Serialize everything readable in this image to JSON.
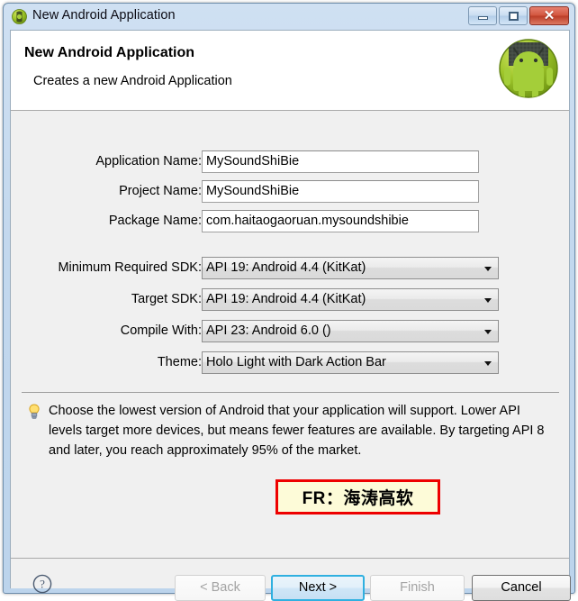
{
  "window": {
    "title": "New Android Application",
    "icon": "android-circle-icon",
    "controls": {
      "minimize": "minimize-icon",
      "maximize": "maximize-icon",
      "close": "close-icon"
    }
  },
  "header": {
    "title": "New Android Application",
    "subtitle": "Creates a new Android Application",
    "logo": "android-robot-icon"
  },
  "form": {
    "text_fields": [
      {
        "label": "Application Name:",
        "value": "MySoundShiBie",
        "info": "i"
      },
      {
        "label": "Project Name:",
        "value": "MySoundShiBie",
        "info": "i"
      },
      {
        "label": "Package Name:",
        "value": "com.haitaogaoruan.mysoundshibie",
        "info": "i"
      }
    ],
    "combo_fields": [
      {
        "label": "Minimum Required SDK:",
        "value": "API 19: Android 4.4 (KitKat)",
        "info": "i"
      },
      {
        "label": "Target SDK:",
        "value": "API 19: Android 4.4 (KitKat)",
        "info": "i"
      },
      {
        "label": "Compile With:",
        "value": "API 23: Android 6.0 ()",
        "info": "i"
      },
      {
        "label": "Theme:",
        "value": "Holo Light with Dark Action Bar",
        "info": "i"
      }
    ]
  },
  "hint": {
    "icon": "lightbulb-icon",
    "text": "Choose the lowest version of Android that your application will support. Lower API levels target more devices, but means fewer features are available. By targeting API 8 and later, you reach approximately 95% of the market."
  },
  "watermark": {
    "text": "FR：海涛高软",
    "border_color": "#ee0000",
    "background_color": "#fdfbd8"
  },
  "buttons": {
    "help": "?",
    "back": "< Back",
    "next": "Next >",
    "finish": "Finish",
    "cancel": "Cancel"
  },
  "colors": {
    "accent": "#2fb0e0",
    "dialog_bg": "#f0f0f0",
    "frame": "#bcd4ec"
  }
}
